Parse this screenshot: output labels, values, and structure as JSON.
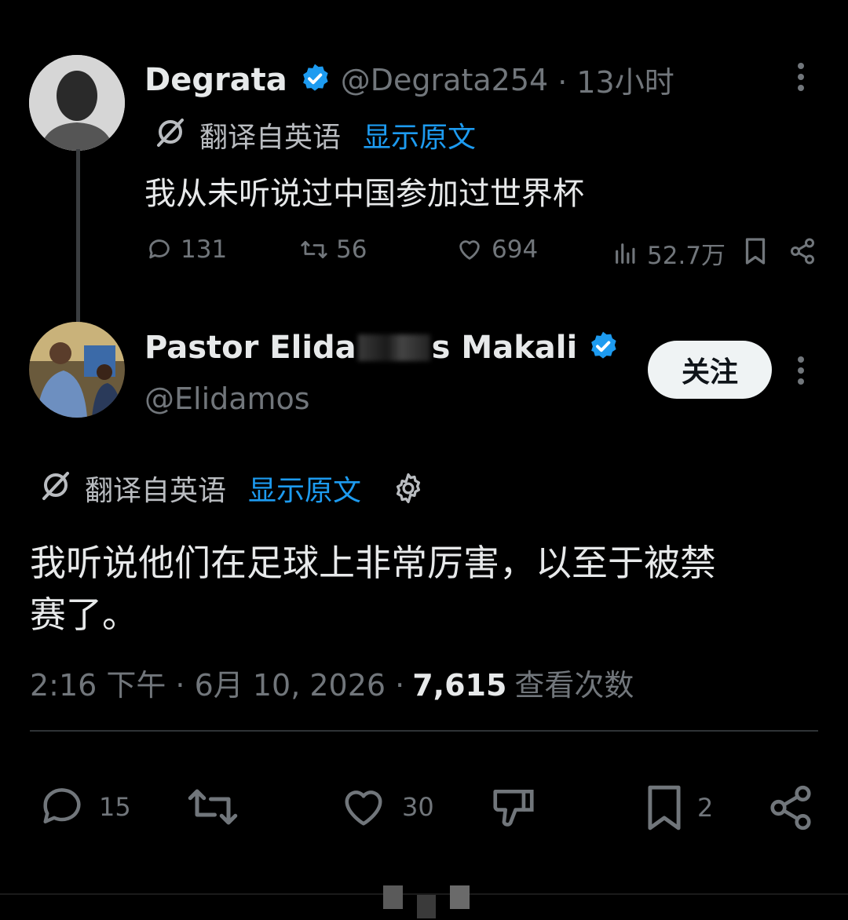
{
  "tweet1": {
    "name": "Degrata",
    "handle": "@Degrata254",
    "time": "· 13小时",
    "translated_label": "翻译自英语",
    "show_original": "显示原文",
    "text": "我从未听说过中国参加过世界杯",
    "stats": {
      "replies": "131",
      "retweets": "56",
      "likes": "694",
      "views": "52.7万"
    }
  },
  "tweet2": {
    "name_part1": "Pastor Elida",
    "name_part2": "s Makali",
    "handle": "@Elidamos",
    "follow_label": "关注",
    "translated_label": "翻译自英语",
    "show_original": "显示原文",
    "text_line1": "我听说他们在足球上非常厉害，以至于被禁",
    "text_line2": "赛了。",
    "time": "2:16 下午",
    "date": "· 6月 10, 2026 ·",
    "views_count": "7,615",
    "views_label": "查看次数",
    "actions": {
      "replies": "15",
      "likes": "30",
      "bookmarks": "2"
    }
  },
  "colors": {
    "background": "#000000",
    "text": "#e7e9ea",
    "muted": "#71767b",
    "accent": "#1d9bf0",
    "follow_bg": "#eff3f4"
  },
  "icons": [
    "verified-badge-icon",
    "translate-icon",
    "more-icon",
    "reply-icon",
    "retweet-icon",
    "like-icon",
    "views-icon",
    "bookmark-icon",
    "share-icon",
    "settings-gear-icon",
    "dislike-icon"
  ]
}
